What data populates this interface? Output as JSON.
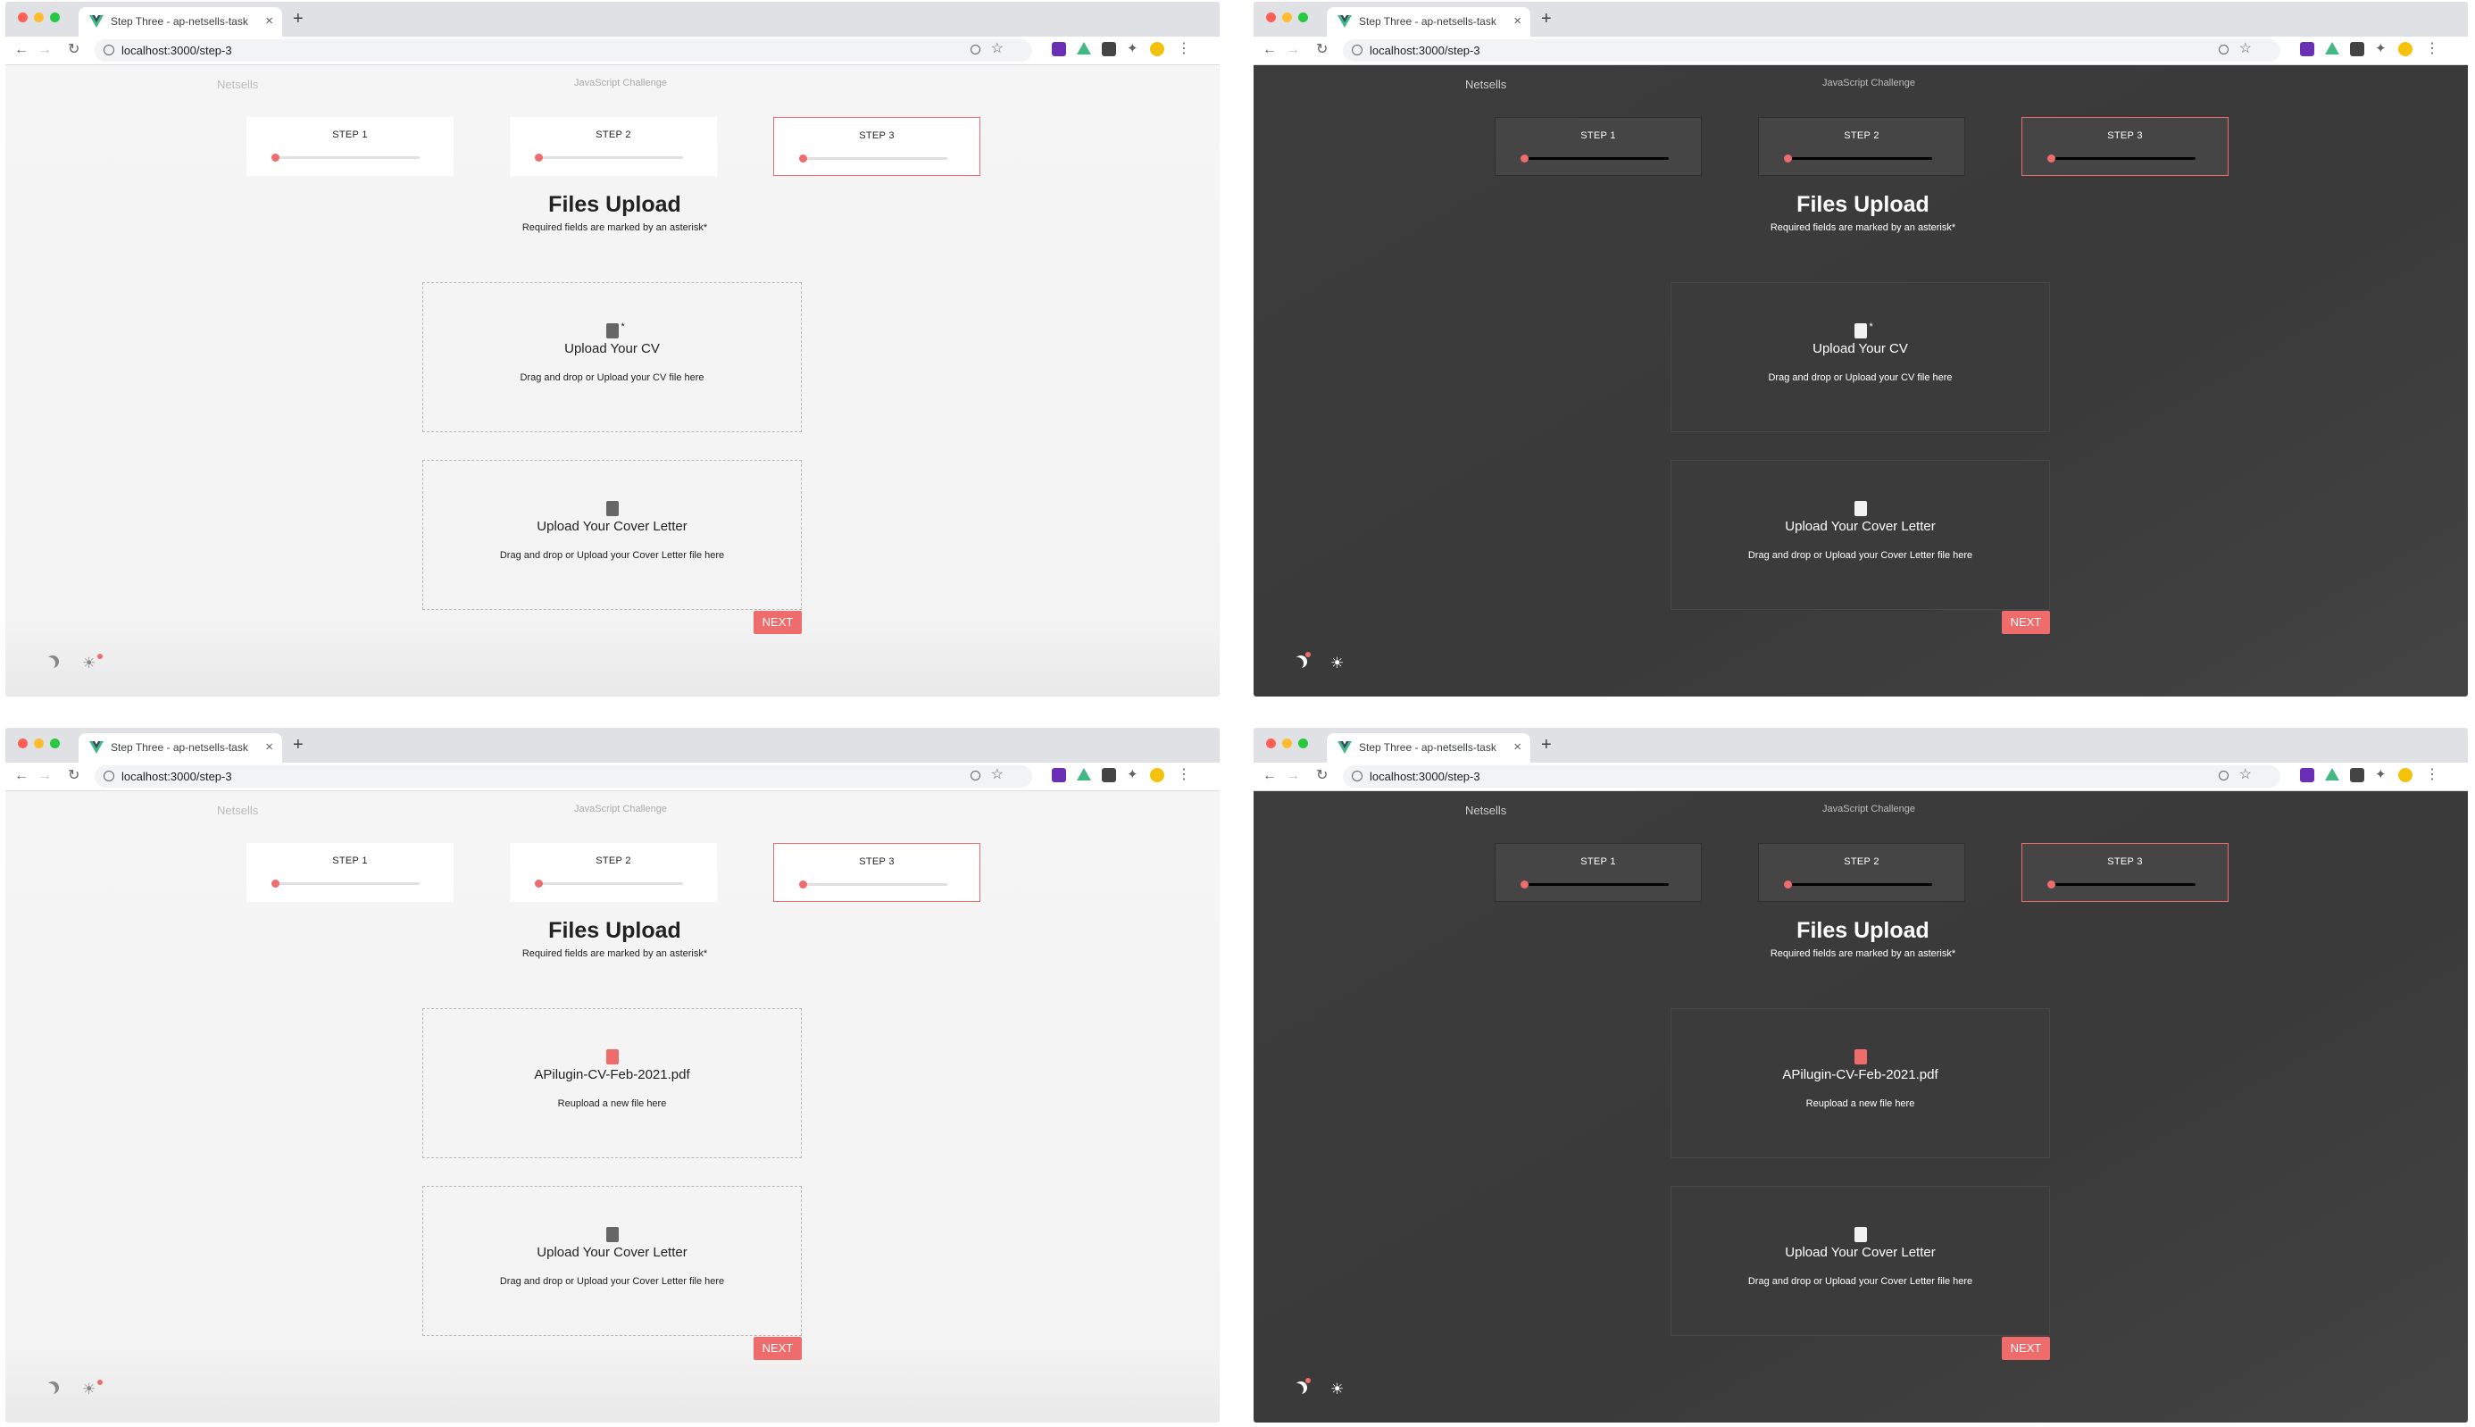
{
  "colors": {
    "accent": "#ef6c6c",
    "dark_bg": "#3c3c3c",
    "light_bg": "#f5f5f5"
  },
  "browser": {
    "tab_titles": [
      "Step Three - ap-netsells-task",
      "Step Three - ap-netsells-task",
      "Step Three - ap-netsells-task",
      "Step Three - ap-netsells-task"
    ],
    "new_tab_label": "+",
    "close_label": "×",
    "url": "localhost:3000/step-3"
  },
  "app": {
    "brand": "Netsells",
    "challenge": "JavaScript Challenge",
    "steps": [
      "STEP 1",
      "STEP 2",
      "STEP 3"
    ],
    "heading": "Files Upload",
    "required_note": "Required fields are marked by an asterisk*",
    "required_marker": "*",
    "cv_title": "Upload Your CV",
    "cv_hint": "Drag and drop or Upload your CV file here",
    "cv_uploaded_name": "APilugin-CV-Feb-2021.pdf",
    "cv_reupload_hint": "Reupload a new file here",
    "cover_title": "Upload Your Cover Letter",
    "cover_hint": "Drag and drop or Upload your Cover Letter file here",
    "next_label": "NEXT"
  },
  "panels": [
    {
      "theme": "light",
      "cv_uploaded": false
    },
    {
      "theme": "dark",
      "cv_uploaded": false
    },
    {
      "theme": "light",
      "cv_uploaded": true
    },
    {
      "theme": "dark",
      "cv_uploaded": true
    }
  ]
}
